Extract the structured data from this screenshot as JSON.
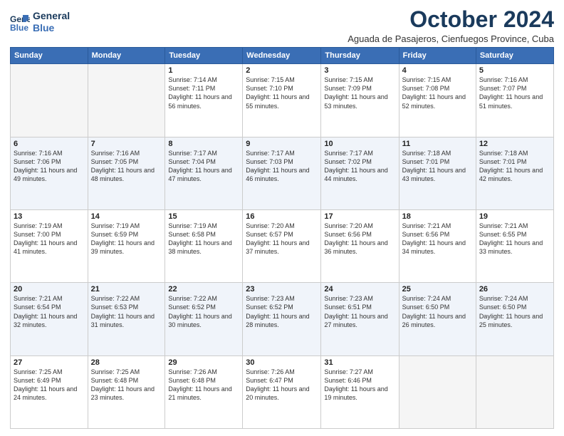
{
  "logo": {
    "line1": "General",
    "line2": "Blue"
  },
  "title": "October 2024",
  "location": "Aguada de Pasajeros, Cienfuegos Province, Cuba",
  "days_of_week": [
    "Sunday",
    "Monday",
    "Tuesday",
    "Wednesday",
    "Thursday",
    "Friday",
    "Saturday"
  ],
  "weeks": [
    [
      {
        "day": "",
        "info": ""
      },
      {
        "day": "",
        "info": ""
      },
      {
        "day": "1",
        "info": "Sunrise: 7:14 AM\nSunset: 7:11 PM\nDaylight: 11 hours and 56 minutes."
      },
      {
        "day": "2",
        "info": "Sunrise: 7:15 AM\nSunset: 7:10 PM\nDaylight: 11 hours and 55 minutes."
      },
      {
        "day": "3",
        "info": "Sunrise: 7:15 AM\nSunset: 7:09 PM\nDaylight: 11 hours and 53 minutes."
      },
      {
        "day": "4",
        "info": "Sunrise: 7:15 AM\nSunset: 7:08 PM\nDaylight: 11 hours and 52 minutes."
      },
      {
        "day": "5",
        "info": "Sunrise: 7:16 AM\nSunset: 7:07 PM\nDaylight: 11 hours and 51 minutes."
      }
    ],
    [
      {
        "day": "6",
        "info": "Sunrise: 7:16 AM\nSunset: 7:06 PM\nDaylight: 11 hours and 49 minutes."
      },
      {
        "day": "7",
        "info": "Sunrise: 7:16 AM\nSunset: 7:05 PM\nDaylight: 11 hours and 48 minutes."
      },
      {
        "day": "8",
        "info": "Sunrise: 7:17 AM\nSunset: 7:04 PM\nDaylight: 11 hours and 47 minutes."
      },
      {
        "day": "9",
        "info": "Sunrise: 7:17 AM\nSunset: 7:03 PM\nDaylight: 11 hours and 46 minutes."
      },
      {
        "day": "10",
        "info": "Sunrise: 7:17 AM\nSunset: 7:02 PM\nDaylight: 11 hours and 44 minutes."
      },
      {
        "day": "11",
        "info": "Sunrise: 7:18 AM\nSunset: 7:01 PM\nDaylight: 11 hours and 43 minutes."
      },
      {
        "day": "12",
        "info": "Sunrise: 7:18 AM\nSunset: 7:01 PM\nDaylight: 11 hours and 42 minutes."
      }
    ],
    [
      {
        "day": "13",
        "info": "Sunrise: 7:19 AM\nSunset: 7:00 PM\nDaylight: 11 hours and 41 minutes."
      },
      {
        "day": "14",
        "info": "Sunrise: 7:19 AM\nSunset: 6:59 PM\nDaylight: 11 hours and 39 minutes."
      },
      {
        "day": "15",
        "info": "Sunrise: 7:19 AM\nSunset: 6:58 PM\nDaylight: 11 hours and 38 minutes."
      },
      {
        "day": "16",
        "info": "Sunrise: 7:20 AM\nSunset: 6:57 PM\nDaylight: 11 hours and 37 minutes."
      },
      {
        "day": "17",
        "info": "Sunrise: 7:20 AM\nSunset: 6:56 PM\nDaylight: 11 hours and 36 minutes."
      },
      {
        "day": "18",
        "info": "Sunrise: 7:21 AM\nSunset: 6:56 PM\nDaylight: 11 hours and 34 minutes."
      },
      {
        "day": "19",
        "info": "Sunrise: 7:21 AM\nSunset: 6:55 PM\nDaylight: 11 hours and 33 minutes."
      }
    ],
    [
      {
        "day": "20",
        "info": "Sunrise: 7:21 AM\nSunset: 6:54 PM\nDaylight: 11 hours and 32 minutes."
      },
      {
        "day": "21",
        "info": "Sunrise: 7:22 AM\nSunset: 6:53 PM\nDaylight: 11 hours and 31 minutes."
      },
      {
        "day": "22",
        "info": "Sunrise: 7:22 AM\nSunset: 6:52 PM\nDaylight: 11 hours and 30 minutes."
      },
      {
        "day": "23",
        "info": "Sunrise: 7:23 AM\nSunset: 6:52 PM\nDaylight: 11 hours and 28 minutes."
      },
      {
        "day": "24",
        "info": "Sunrise: 7:23 AM\nSunset: 6:51 PM\nDaylight: 11 hours and 27 minutes."
      },
      {
        "day": "25",
        "info": "Sunrise: 7:24 AM\nSunset: 6:50 PM\nDaylight: 11 hours and 26 minutes."
      },
      {
        "day": "26",
        "info": "Sunrise: 7:24 AM\nSunset: 6:50 PM\nDaylight: 11 hours and 25 minutes."
      }
    ],
    [
      {
        "day": "27",
        "info": "Sunrise: 7:25 AM\nSunset: 6:49 PM\nDaylight: 11 hours and 24 minutes."
      },
      {
        "day": "28",
        "info": "Sunrise: 7:25 AM\nSunset: 6:48 PM\nDaylight: 11 hours and 23 minutes."
      },
      {
        "day": "29",
        "info": "Sunrise: 7:26 AM\nSunset: 6:48 PM\nDaylight: 11 hours and 21 minutes."
      },
      {
        "day": "30",
        "info": "Sunrise: 7:26 AM\nSunset: 6:47 PM\nDaylight: 11 hours and 20 minutes."
      },
      {
        "day": "31",
        "info": "Sunrise: 7:27 AM\nSunset: 6:46 PM\nDaylight: 11 hours and 19 minutes."
      },
      {
        "day": "",
        "info": ""
      },
      {
        "day": "",
        "info": ""
      }
    ]
  ]
}
